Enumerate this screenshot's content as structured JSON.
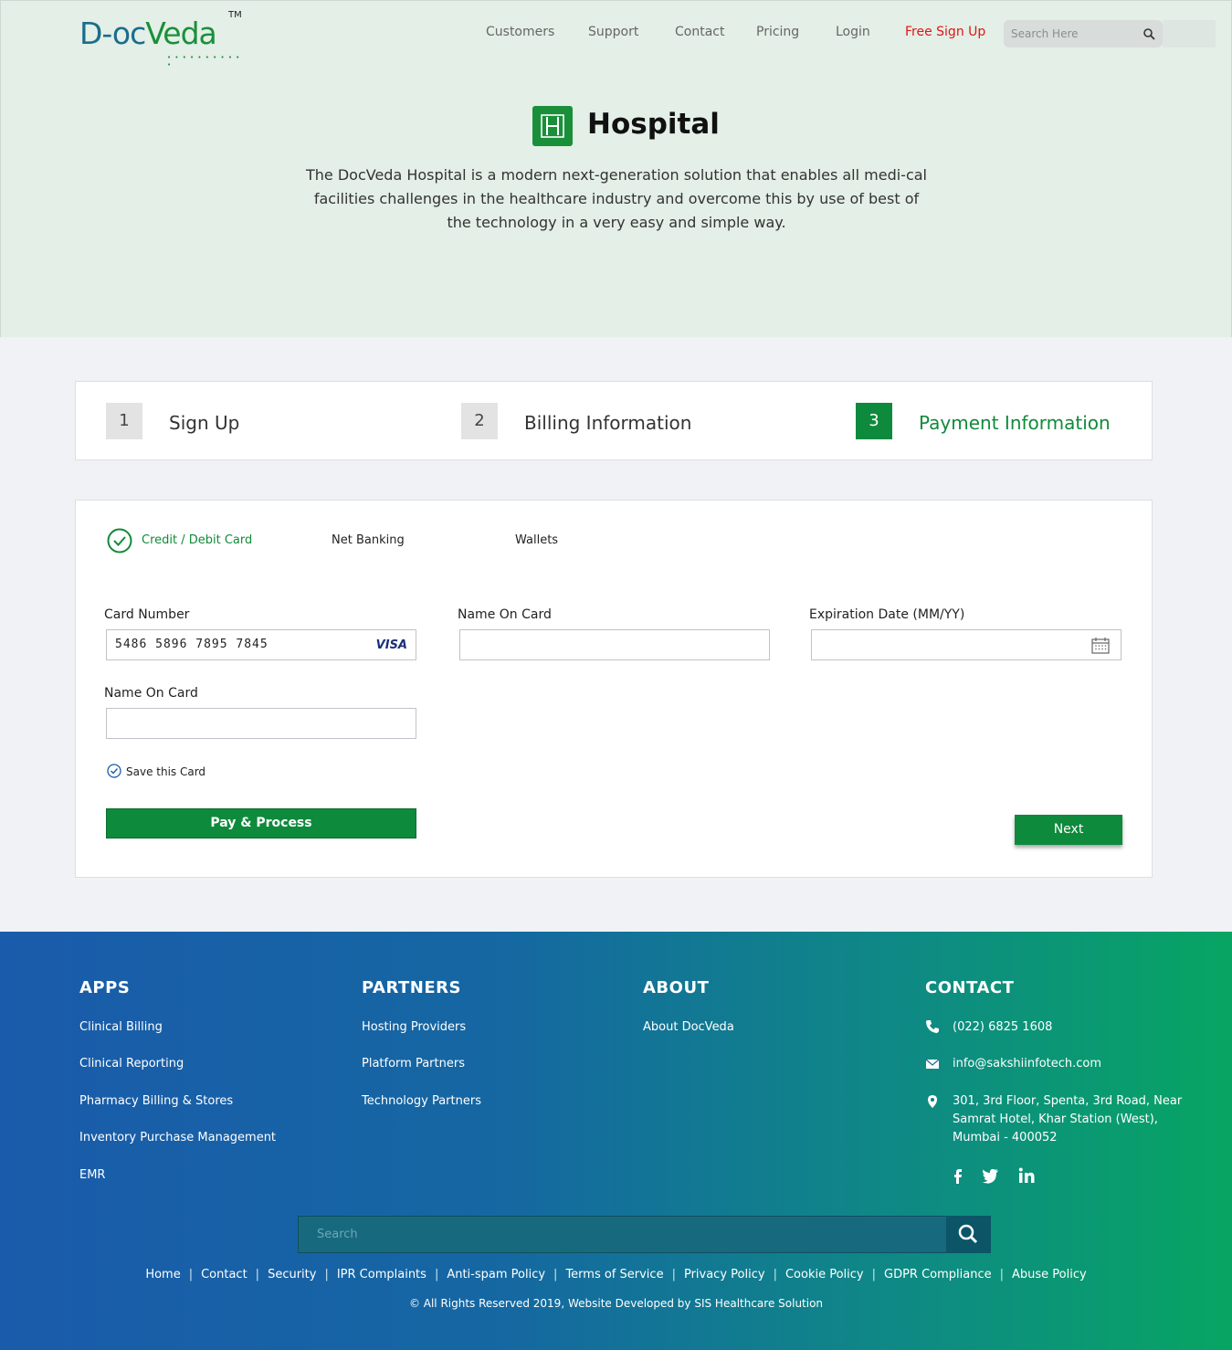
{
  "header": {
    "logo": {
      "part1": "D-oc",
      "part2": "Veda",
      "tm": "TM"
    },
    "nav": [
      {
        "label": "Customers"
      },
      {
        "label": "Support"
      },
      {
        "label": "Contact"
      },
      {
        "label": "Pricing"
      },
      {
        "label": "Login"
      },
      {
        "label": "Free Sign Up"
      }
    ],
    "search": {
      "placeholder": "Search Here",
      "icon": "search-icon"
    }
  },
  "hero": {
    "title": "Hospital",
    "icon": "hospital-icon",
    "description": "The DocVeda Hospital is a modern next-generation solution that enables all medi-cal facilities challenges in the healthcare industry and overcome this by use of best of the technology in a very easy and simple way."
  },
  "steps": [
    {
      "number": "1",
      "label": "Sign Up",
      "active": false
    },
    {
      "number": "2",
      "label": "Billing Information",
      "active": false
    },
    {
      "number": "3",
      "label": "Payment Information",
      "active": true
    }
  ],
  "payment": {
    "tabs": [
      {
        "label": "Credit / Debit Card",
        "active": true
      },
      {
        "label": "Net Banking",
        "active": false
      },
      {
        "label": "Wallets",
        "active": false
      }
    ],
    "fields": {
      "card_number": {
        "label": "Card Number",
        "value": "5486 5896 7895 7845",
        "brand": "VISA"
      },
      "name_on_card": {
        "label": "Name On Card",
        "value": ""
      },
      "expiration": {
        "label": "Expiration Date (MM/YY)",
        "value": ""
      },
      "name_on_card_2": {
        "label": "Name On Card",
        "value": ""
      }
    },
    "save_card_label": "Save this Card",
    "pay_button": "Pay & Process",
    "next_button": "Next"
  },
  "footer": {
    "apps": {
      "title": "APPS",
      "items": [
        "Clinical Billing",
        "Clinical Reporting",
        "Pharmacy Billing & Stores",
        "Inventory Purchase Management",
        "EMR"
      ]
    },
    "partners": {
      "title": "PARTNERS",
      "items": [
        "Hosting Providers",
        "Platform Partners",
        "Technology Partners"
      ]
    },
    "about": {
      "title": "ABOUT",
      "items": [
        "About DocVeda"
      ]
    },
    "contact": {
      "title": "CONTACT",
      "phone": "(022) 6825 1608",
      "email": "info@sakshiinfotech.com",
      "address_lines": [
        "301, 3rd Floor, Spenta, 3rd Road, Near",
        "Samrat Hotel, Khar Station (West),",
        "Mumbai - 400052"
      ]
    },
    "social": [
      "facebook-icon",
      "twitter-icon",
      "linkedin-icon"
    ],
    "search_placeholder": "Search",
    "links": [
      "Home",
      "Contact",
      "Security",
      "IPR Complaints",
      "Anti-spam Policy",
      "Terms of Service",
      "Privacy Policy",
      "Cookie Policy",
      "GDPR Compliance",
      "Abuse Policy"
    ],
    "copyright": "© All Rights Reserved 2019, Website Developed by SIS Healthcare Solution"
  },
  "colors": {
    "brand_green": "#0e8a3c",
    "brand_blue": "#1a6d8c",
    "signup_red": "#e01515"
  }
}
